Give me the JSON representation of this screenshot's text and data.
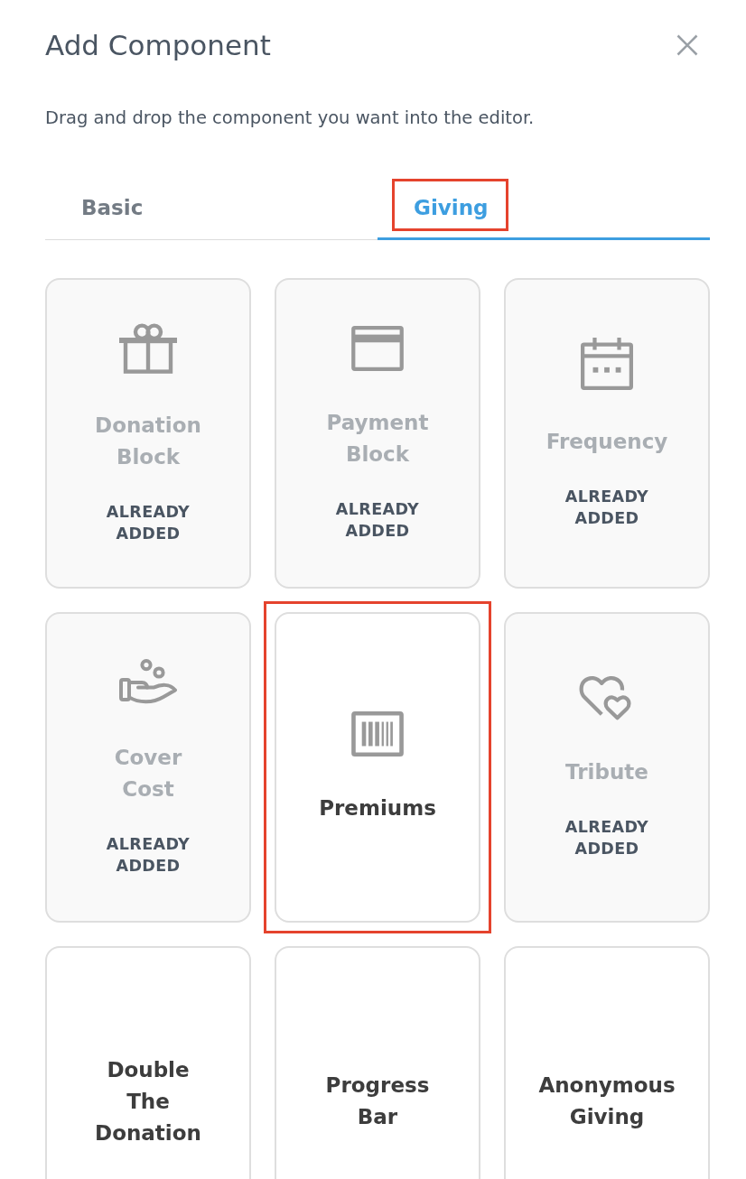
{
  "dialog": {
    "title": "Add Component",
    "description": "Drag and drop the component you want into the editor."
  },
  "tabs": [
    {
      "label": "Basic",
      "selected": false,
      "highlighted": false
    },
    {
      "label": "Giving",
      "selected": true,
      "highlighted": true
    }
  ],
  "components": [
    {
      "name": "Donation Block",
      "added": true,
      "status": "ALREADY ADDED",
      "highlighted": false
    },
    {
      "name": "Payment Block",
      "added": true,
      "status": "ALREADY ADDED",
      "highlighted": false
    },
    {
      "name": "Frequency",
      "added": true,
      "status": "ALREADY ADDED",
      "highlighted": false
    },
    {
      "name": "Cover Cost",
      "added": true,
      "status": "ALREADY ADDED",
      "highlighted": false
    },
    {
      "name": "Premiums",
      "added": false,
      "highlighted": true
    },
    {
      "name": "Tribute",
      "added": true,
      "status": "ALREADY ADDED",
      "highlighted": false
    },
    {
      "name": "Double The Donation",
      "added": false,
      "highlighted": false
    },
    {
      "name": "Progress Bar",
      "added": false,
      "highlighted": false
    },
    {
      "name": "Anonymous Giving",
      "added": false,
      "highlighted": false
    }
  ]
}
